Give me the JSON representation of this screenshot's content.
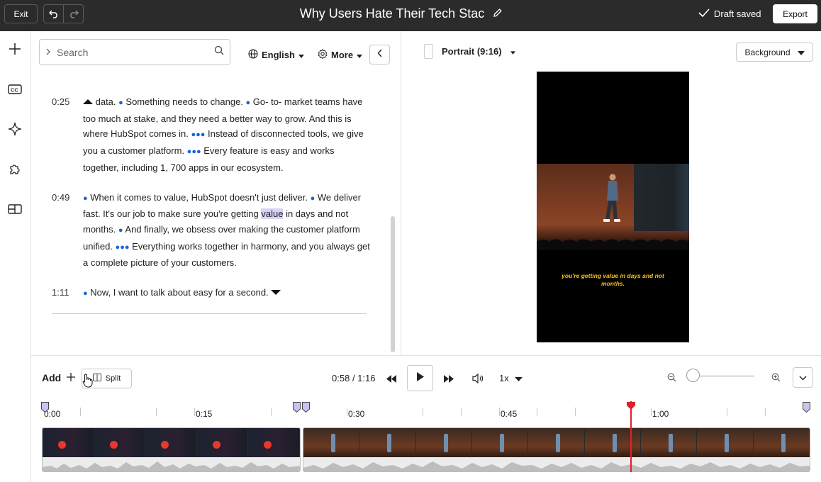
{
  "topbar": {
    "exit_label": "Exit",
    "title": "Why Users Hate Their Tech Stac",
    "draft_status": "Draft saved",
    "export_label": "Export"
  },
  "rail": {
    "icons": [
      "plus-icon",
      "captions-icon",
      "sparkle-icon",
      "puzzle-icon",
      "layout-icon"
    ]
  },
  "transcript_panel": {
    "search_placeholder": "Search",
    "language": "English",
    "more_label": "More",
    "paragraphs": [
      {
        "timestamp": "0:25",
        "segments": [
          {
            "type": "marker",
            "icon": "caret-up-icon"
          },
          {
            "type": "text",
            "text": " data. "
          },
          {
            "type": "pause",
            "dots": "●"
          },
          {
            "type": "text",
            "text": " Something needs to change. "
          },
          {
            "type": "pause",
            "dots": "●"
          },
          {
            "type": "text",
            "text": " Go- to- market teams have too much at stake, and they need a better way to grow. And this is where HubSpot comes in. "
          },
          {
            "type": "pause",
            "dots": "●●●"
          },
          {
            "type": "text",
            "text": " Instead of disconnected tools, we give you a customer platform. "
          },
          {
            "type": "pause",
            "dots": "●●●"
          },
          {
            "type": "text",
            "text": " Every feature is easy and works together, including 1, 700 apps in our ecosystem."
          }
        ]
      },
      {
        "timestamp": "0:49",
        "segments": [
          {
            "type": "pause",
            "dots": "●"
          },
          {
            "type": "text",
            "text": " When it comes to value, HubSpot doesn't just deliver. "
          },
          {
            "type": "pause",
            "dots": "●"
          },
          {
            "type": "text",
            "text": " We deliver fast. It's our job to make sure you're getting "
          },
          {
            "type": "highlight",
            "text": "value"
          },
          {
            "type": "text",
            "text": " in days and not months. "
          },
          {
            "type": "pause",
            "dots": "●"
          },
          {
            "type": "text",
            "text": " And finally, we obsess over making the customer platform unified. "
          },
          {
            "type": "pause",
            "dots": "●●●"
          },
          {
            "type": "text",
            "text": " Everything works together in harmony, and you always get a complete picture of your customers."
          }
        ]
      },
      {
        "timestamp": "1:11",
        "segments": [
          {
            "type": "pause",
            "dots": "●"
          },
          {
            "type": "text",
            "text": " Now, I want to talk about easy for a second. "
          },
          {
            "type": "marker",
            "icon": "caret-down-icon"
          }
        ]
      }
    ]
  },
  "preview": {
    "aspect_label": "Portrait (9:16)",
    "background_label": "Background",
    "caption_text": "you're getting value in days and not months."
  },
  "controls": {
    "add_label": "Add",
    "split_label": "Split",
    "current_time": "0:58",
    "duration": "1:16",
    "speed": "1x"
  },
  "timeline": {
    "ruler_labels": [
      "0:00",
      "0:15",
      "0:30",
      "0:45",
      "1:00"
    ],
    "playhead_time": "0:58",
    "colors": {
      "playhead": "#e0202a",
      "pause_dot": "#1a63d8",
      "highlight": "#d9d2f7",
      "caption": "#f6c21b"
    }
  }
}
